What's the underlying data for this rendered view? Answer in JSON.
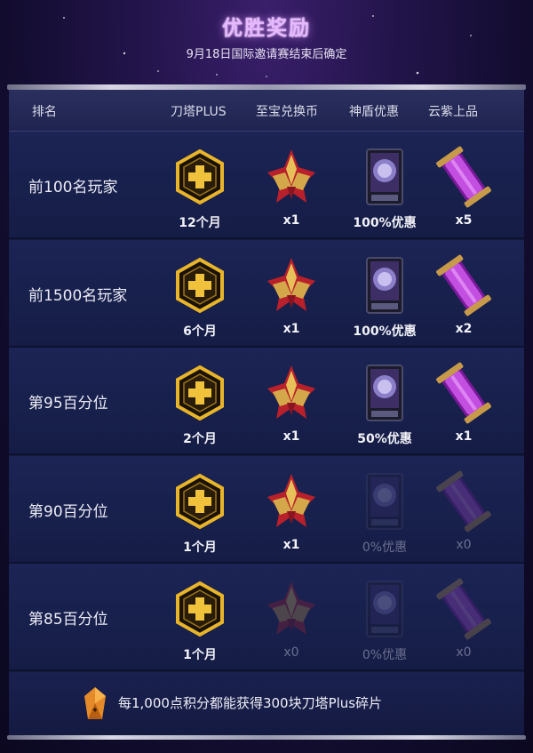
{
  "header": {
    "title": "优胜奖励",
    "subtitle": "9月18日国际邀请赛结束后确定"
  },
  "table": {
    "columns": [
      "排名",
      "刀塔PLUS",
      "至宝兑换币",
      "神盾优惠",
      "云紫上品"
    ],
    "rows": [
      {
        "label": "前100名玩家",
        "plus": "12个月",
        "coin": "x1",
        "aegis": "100%优惠",
        "treasure": "x5",
        "dim": [
          false,
          false,
          false,
          false
        ]
      },
      {
        "label": "前1500名玩家",
        "plus": "6个月",
        "coin": "x1",
        "aegis": "100%优惠",
        "treasure": "x2",
        "dim": [
          false,
          false,
          false,
          false
        ]
      },
      {
        "label": "第95百分位",
        "plus": "2个月",
        "coin": "x1",
        "aegis": "50%优惠",
        "treasure": "x1",
        "dim": [
          false,
          false,
          false,
          false
        ]
      },
      {
        "label": "第90百分位",
        "plus": "1个月",
        "coin": "x1",
        "aegis": "0%优惠",
        "treasure": "x0",
        "dim": [
          false,
          false,
          true,
          true
        ]
      },
      {
        "label": "第85百分位",
        "plus": "1个月",
        "coin": "x0",
        "aegis": "0%优惠",
        "treasure": "x0",
        "dim": [
          false,
          true,
          true,
          true
        ]
      }
    ]
  },
  "footer": {
    "text": "每1,000点积分都能获得300块刀塔Plus碎片",
    "icon": "plus-shard-icon"
  },
  "icons": [
    "plus-hexagon-icon",
    "arcana-coin-icon",
    "aegis-discount-card-icon",
    "treasure-chest-icon"
  ],
  "colors": {
    "accent_title": "#e6b8ff",
    "plus_gold": "#e8b52a",
    "treasure_purple": "#b040d8",
    "coin_red": "#c8222e"
  }
}
